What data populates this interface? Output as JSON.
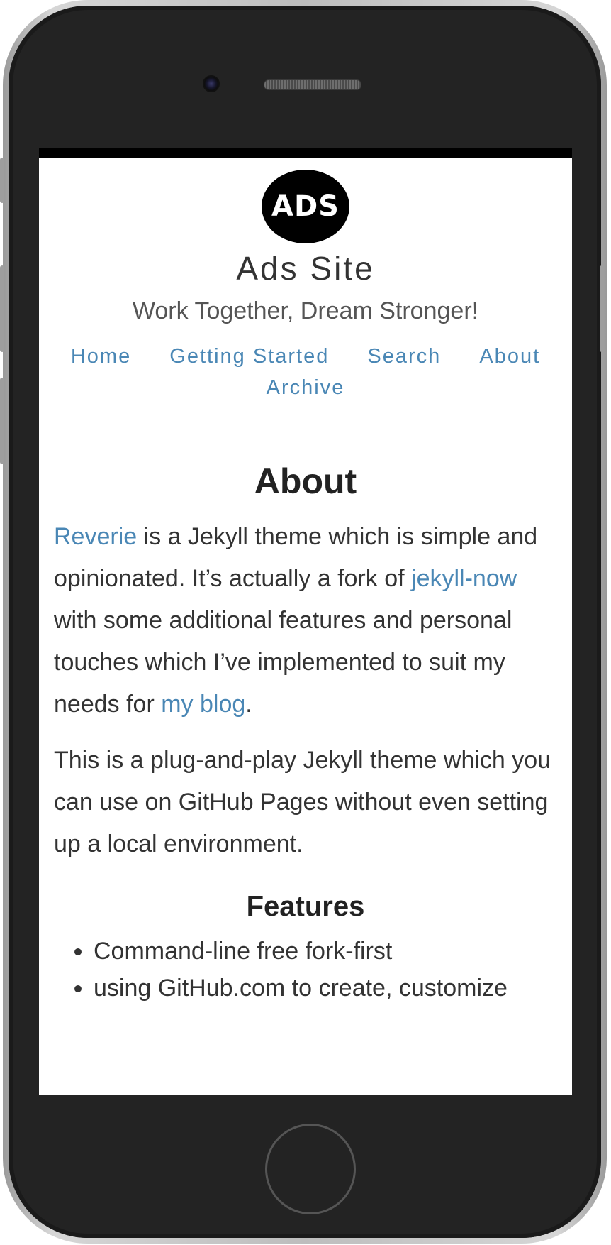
{
  "site": {
    "logo_text": "ADS",
    "name": "Ads Site",
    "tagline": "Work Together, Dream Stronger!"
  },
  "nav": {
    "items": [
      "Home",
      "Getting Started",
      "Search",
      "About",
      "Archive"
    ]
  },
  "page": {
    "title": "About",
    "para1": {
      "link_reverie": "Reverie",
      "text1": " is a Jekyll theme which is simple and opinionated. It’s actually a fork of ",
      "link_jekyll_now": "jekyll-now",
      "text2": " with some additional features and personal touches which I’ve implemented to suit my needs for ",
      "link_blog": "my blog",
      "text3": "."
    },
    "para2": "This is a plug-and-play Jekyll theme which you can use on GitHub Pages without even setting up a local environment.",
    "features_title": "Features",
    "features": [
      "Command-line free fork-first",
      "using GitHub.com to create, customize"
    ]
  },
  "colors": {
    "link": "#4a87b5",
    "text": "#333333",
    "phone_body": "#232323",
    "logo_bg": "#000000"
  },
  "icons": [
    "camera-icon",
    "speaker-grille",
    "home-button"
  ]
}
